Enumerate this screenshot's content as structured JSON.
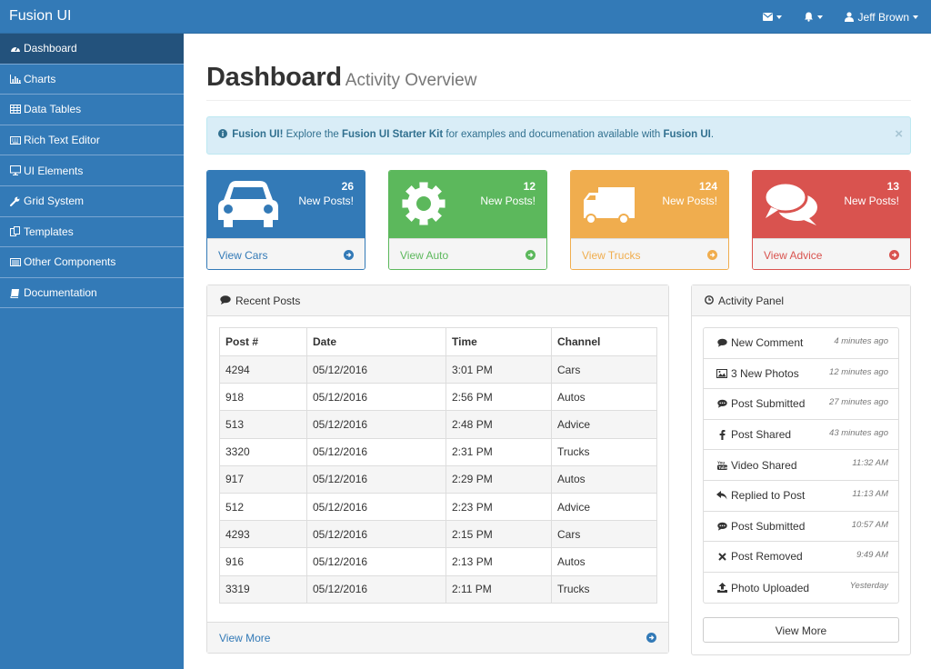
{
  "app": {
    "brand": "Fusion UI"
  },
  "navbar": {
    "messages_icon": "envelope-icon",
    "alerts_icon": "bell-icon",
    "user_name": "Jeff Brown"
  },
  "sidebar": {
    "items": [
      {
        "label": "Dashboard",
        "icon": "dashboard-icon",
        "active": true
      },
      {
        "label": "Charts",
        "icon": "bar-chart-icon"
      },
      {
        "label": "Data Tables",
        "icon": "table-icon"
      },
      {
        "label": "Rich Text Editor",
        "icon": "keyboard-icon"
      },
      {
        "label": "UI Elements",
        "icon": "desktop-icon"
      },
      {
        "label": "Grid System",
        "icon": "wrench-icon"
      },
      {
        "label": "Templates",
        "icon": "copy-icon"
      },
      {
        "label": "Other Components",
        "icon": "list-icon"
      },
      {
        "label": "Documentation",
        "icon": "book-icon"
      }
    ]
  },
  "page": {
    "title": "Dashboard",
    "subtitle": "Activity Overview"
  },
  "alert": {
    "brand": "Fusion UI!",
    "text1": " Explore the ",
    "kit": "Fusion UI Starter Kit",
    "text2": " for examples and documenation available with ",
    "brand2": "Fusion UI",
    "end": ".",
    "close": "×"
  },
  "stats": [
    {
      "count": "26",
      "label": "New Posts!",
      "link": "View Cars",
      "color": "#337ab7",
      "icon": "car-icon"
    },
    {
      "count": "12",
      "label": "New Posts!",
      "link": "View Auto",
      "color": "#5cb85c",
      "icon": "gear-icon"
    },
    {
      "count": "124",
      "label": "New Posts!",
      "link": "View Trucks",
      "color": "#f0ad4e",
      "icon": "truck-icon"
    },
    {
      "count": "13",
      "label": "New Posts!",
      "link": "View Advice",
      "color": "#d9534f",
      "icon": "comments-icon"
    }
  ],
  "recent_posts": {
    "title": "Recent Posts",
    "columns": [
      "Post #",
      "Date",
      "Time",
      "Channel"
    ],
    "rows": [
      [
        "4294",
        "05/12/2016",
        "3:01 PM",
        "Cars"
      ],
      [
        "918",
        "05/12/2016",
        "2:56 PM",
        "Autos"
      ],
      [
        "513",
        "05/12/2016",
        "2:48 PM",
        "Advice"
      ],
      [
        "3320",
        "05/12/2016",
        "2:31 PM",
        "Trucks"
      ],
      [
        "917",
        "05/12/2016",
        "2:29 PM",
        "Autos"
      ],
      [
        "512",
        "05/12/2016",
        "2:23 PM",
        "Advice"
      ],
      [
        "4293",
        "05/12/2016",
        "2:15 PM",
        "Cars"
      ],
      [
        "916",
        "05/12/2016",
        "2:13 PM",
        "Autos"
      ],
      [
        "3319",
        "05/12/2016",
        "2:11 PM",
        "Trucks"
      ]
    ],
    "footer": "View More"
  },
  "activity": {
    "title": "Activity Panel",
    "items": [
      {
        "label": "New Comment",
        "time": "4 minutes ago",
        "icon": "comment-icon"
      },
      {
        "label": "3 New Photos",
        "time": "12 minutes ago",
        "icon": "photo-icon"
      },
      {
        "label": "Post Submitted",
        "time": "27 minutes ago",
        "icon": "comment-dots-icon"
      },
      {
        "label": "Post Shared",
        "time": "43 minutes ago",
        "icon": "facebook-icon"
      },
      {
        "label": "Video Shared",
        "time": "11:32 AM",
        "icon": "youtube-icon"
      },
      {
        "label": "Replied to Post",
        "time": "11:13 AM",
        "icon": "reply-icon"
      },
      {
        "label": "Post Submitted",
        "time": "10:57 AM",
        "icon": "comment-dots-icon"
      },
      {
        "label": "Post Removed",
        "time": "9:49 AM",
        "icon": "times-icon"
      },
      {
        "label": "Photo Uploaded",
        "time": "Yesterday",
        "icon": "upload-icon"
      }
    ],
    "button": "View More"
  }
}
